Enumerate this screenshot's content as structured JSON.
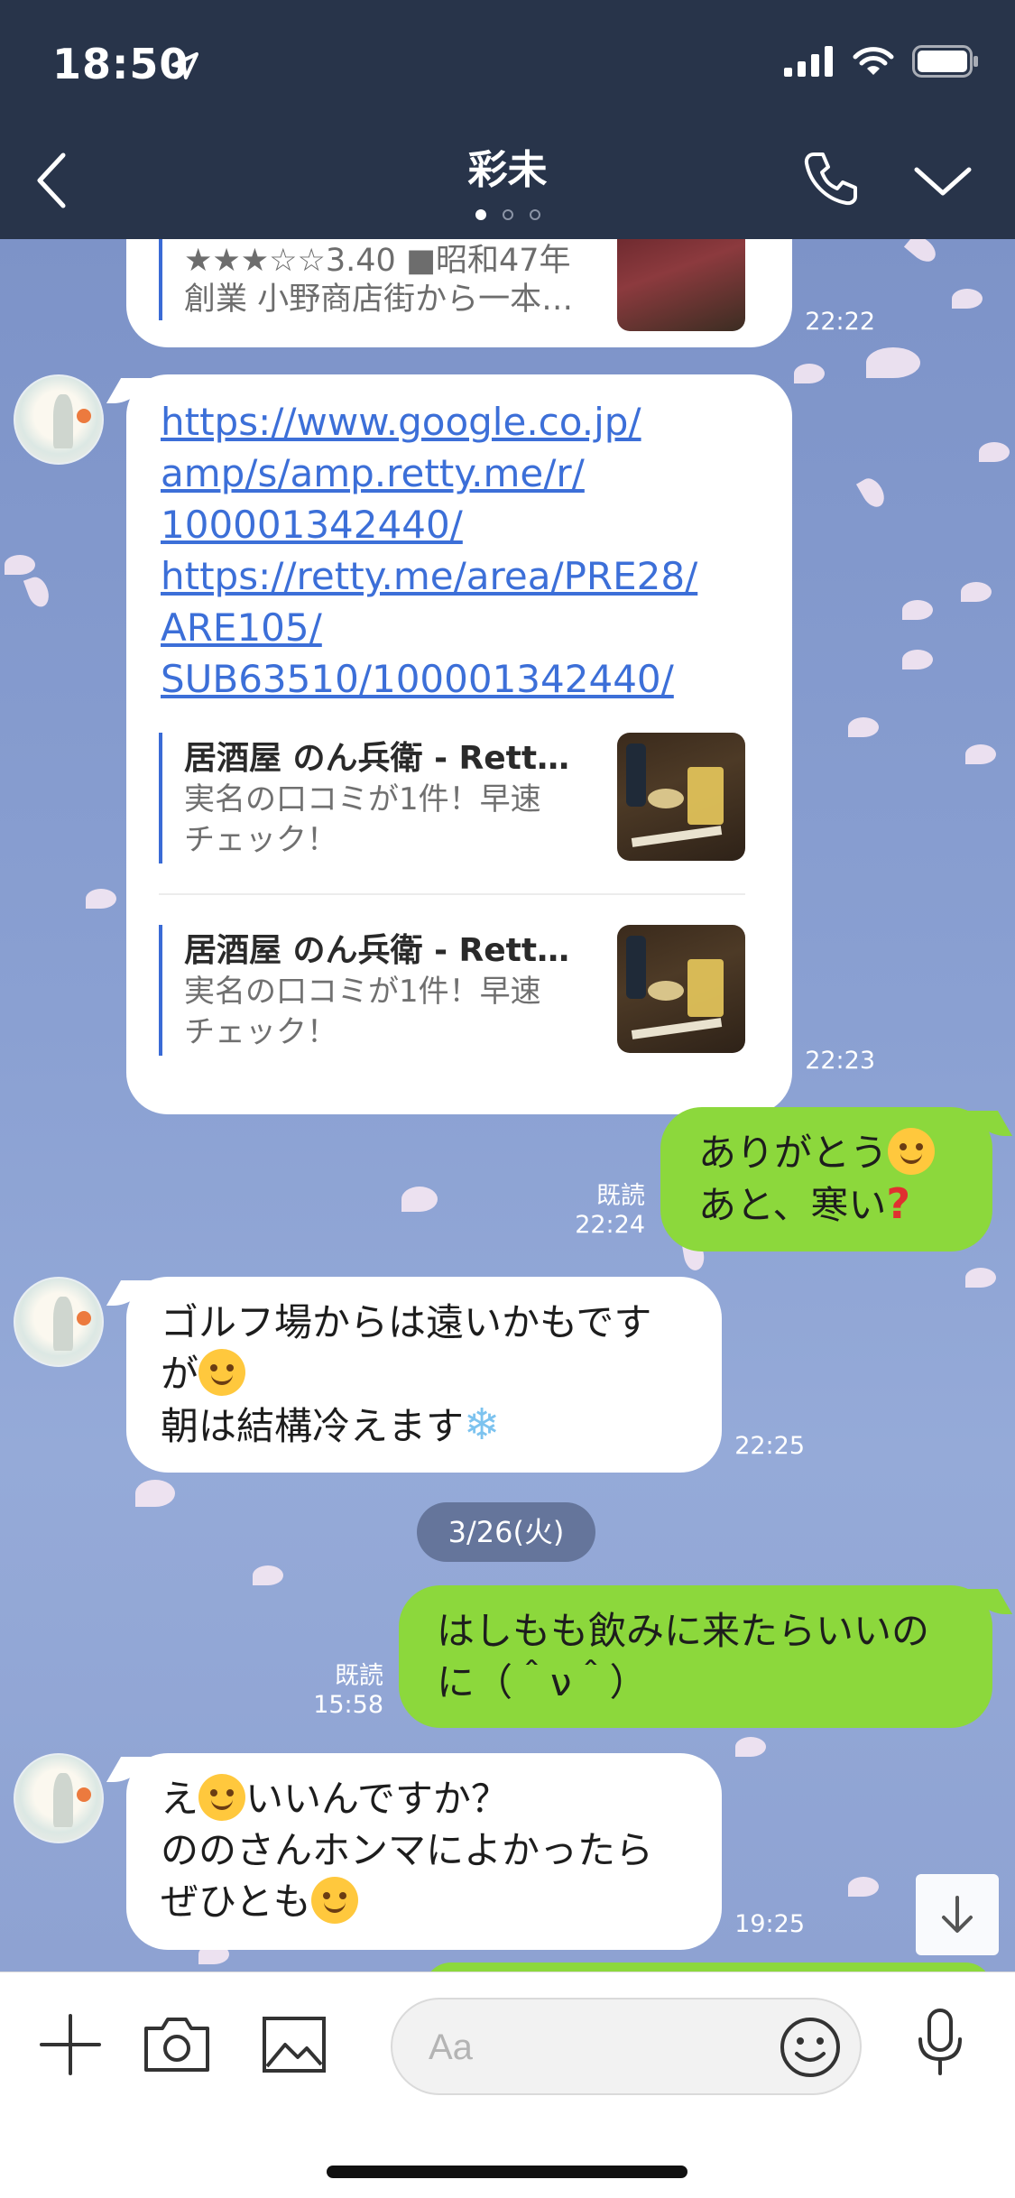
{
  "status": {
    "time": "18:50"
  },
  "nav": {
    "title": "彩未"
  },
  "messages": {
    "m1": {
      "preview_rating_line": "★★★☆☆3.40 ■昭和47年",
      "preview_desc_line": "創業 小野商店街から一本…",
      "time": "22:22"
    },
    "m2": {
      "links": [
        "https://www.google.co.jp/",
        "amp/s/amp.retty.me/r/",
        "100001342440/",
        "https://retty.me/area/PRE28/",
        "ARE105/",
        "SUB63510/100001342440/"
      ],
      "previews": [
        {
          "title": "居酒屋 のん兵衛 - Rett…",
          "desc_line1": "実名の口コミが1件！早速",
          "desc_line2": "チェック！"
        },
        {
          "title": "居酒屋 のん兵衛 - Rett…",
          "desc_line1": "実名の口コミが1件！早速",
          "desc_line2": "チェック！"
        }
      ],
      "time": "22:23"
    },
    "m3": {
      "line1": "ありがとう",
      "line2": "あと、寒い",
      "read": "既読",
      "time": "22:24"
    },
    "m4": {
      "line1": "ゴルフ場からは遠いかもです",
      "line2": "が",
      "line3": "朝は結構冷えます",
      "time": "22:25"
    },
    "date_separator": "3/26(火)",
    "m5": {
      "line1": "はしもも飲みに来たらいいの",
      "line2": "に（＾ν＾）",
      "read": "既読",
      "time": "15:58"
    },
    "m6": {
      "line1_a": "え",
      "line1_b": "いいんですか？",
      "line2": "ののさんホンマによかったら",
      "line3": "ぜひとも",
      "time": "19:25"
    }
  },
  "input": {
    "placeholder": "Aa"
  },
  "icons": {
    "back": "chevron-left-icon",
    "call": "phone-icon",
    "menu": "chevron-down-icon",
    "plus": "plus-icon",
    "camera": "camera-icon",
    "image": "image-icon",
    "emoji": "emoji-icon",
    "mic": "microphone-icon",
    "scroll": "arrow-down-icon"
  },
  "colors": {
    "header": "#28344a",
    "outgoing_bubble": "#8cd83c",
    "link": "#3c6fd8",
    "chat_bg": "#8aa0d2"
  }
}
